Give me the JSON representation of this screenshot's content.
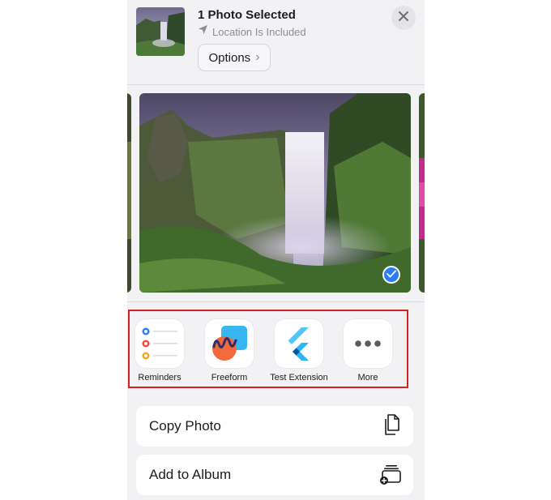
{
  "header": {
    "title": "1 Photo Selected",
    "location_text": "Location Is Included",
    "options_label": "Options",
    "options_chevron": "›"
  },
  "icons": {
    "close": "close-icon",
    "location": "location-arrow-icon",
    "selected": "checkmark-icon"
  },
  "apps": [
    {
      "label": "Reminders",
      "icon": "reminders-icon"
    },
    {
      "label": "Freeform",
      "icon": "freeform-icon"
    },
    {
      "label": "Test Extension",
      "icon": "flutter-icon"
    },
    {
      "label": "More",
      "icon": "more-icon"
    }
  ],
  "actions": [
    {
      "label": "Copy Photo",
      "icon": "copy-icon"
    },
    {
      "label": "Add to Album",
      "icon": "add-to-album-icon"
    }
  ],
  "colors": {
    "accent_blue": "#2d7cf6",
    "highlight_red": "#d32121",
    "sheet_bg": "#f2f2f4"
  }
}
